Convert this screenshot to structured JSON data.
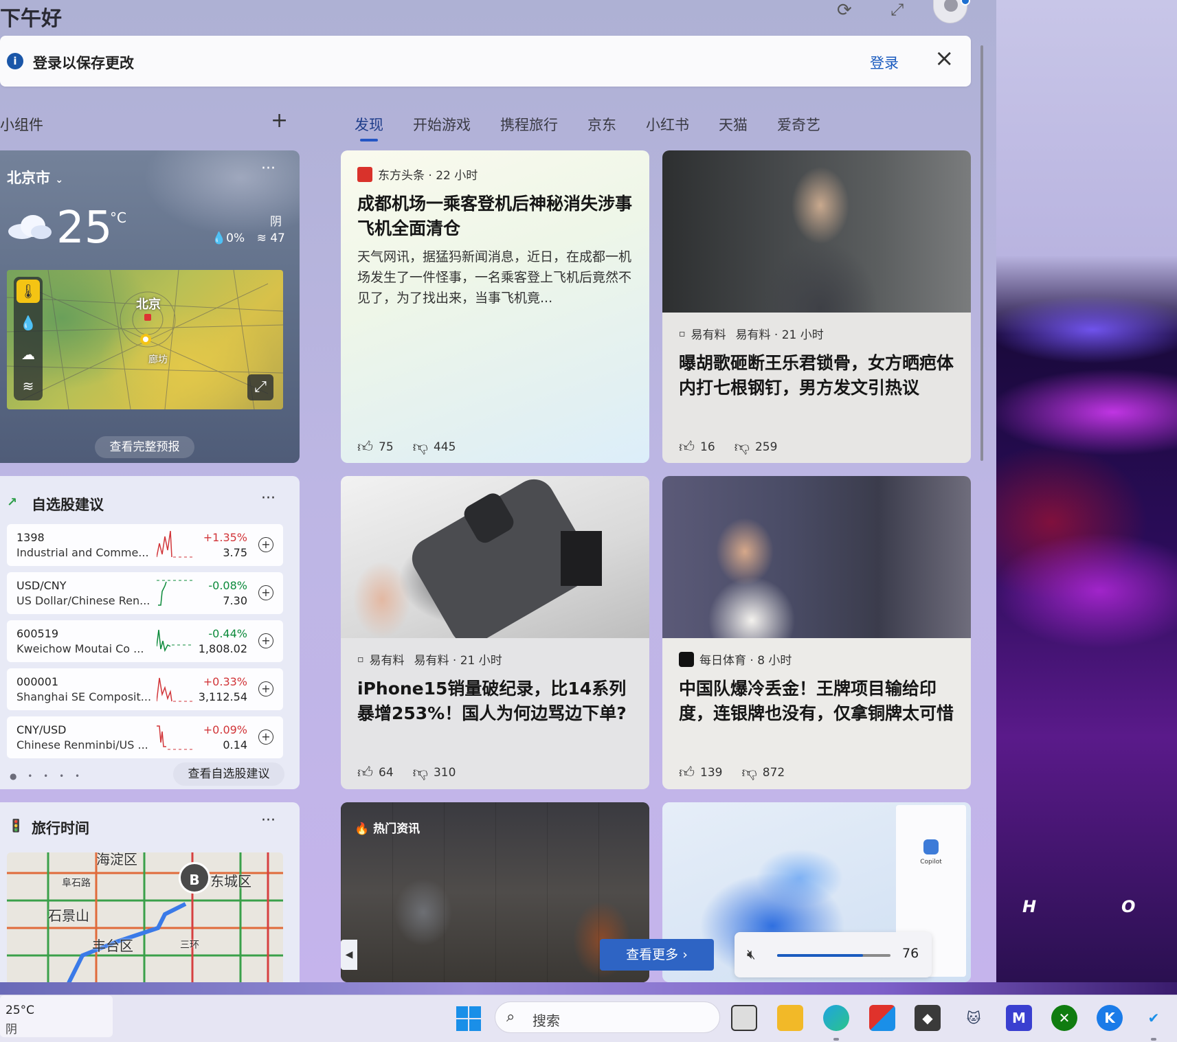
{
  "header": {
    "greeting": "下午好"
  },
  "notice": {
    "message": "登录以保存更改",
    "login_label": "登录"
  },
  "widgets": {
    "title": "小组件"
  },
  "tabs": [
    "发现",
    "开始游戏",
    "携程旅行",
    "京东",
    "小红书",
    "天猫",
    "爱奇艺"
  ],
  "weather": {
    "city": "北京市",
    "temperature": "25",
    "unit": "°C",
    "condition": "阴",
    "precip": "0%",
    "aqi_label": "47",
    "map_labels": {
      "city": "北京",
      "town": "廊坊"
    },
    "forecast_label": "查看完整预报"
  },
  "stocks": {
    "title": "自选股建议",
    "see_label": "查看自选股建议",
    "items": [
      {
        "symbol": "1398",
        "name": "Industrial and Comme...",
        "change": "+1.35%",
        "price": "3.75",
        "direction": "up"
      },
      {
        "symbol": "USD/CNY",
        "name": "US Dollar/Chinese Ren...",
        "change": "-0.08%",
        "price": "7.30",
        "direction": "down"
      },
      {
        "symbol": "600519",
        "name": "Kweichow Moutai Co ...",
        "change": "-0.44%",
        "price": "1,808.02",
        "direction": "down"
      },
      {
        "symbol": "000001",
        "name": "Shanghai SE Composit...",
        "change": "+0.33%",
        "price": "3,112.54",
        "direction": "up"
      },
      {
        "symbol": "CNY/USD",
        "name": "Chinese Renminbi/US ...",
        "change": "+0.09%",
        "price": "0.14",
        "direction": "up"
      }
    ]
  },
  "travel": {
    "title": "旅行时间",
    "map_labels": {
      "a": "海淀区",
      "b": "东城区",
      "c": "石景山",
      "d": "丰台区",
      "e": "阜石路",
      "f": "三环"
    },
    "marker": "B"
  },
  "cards": {
    "c1": {
      "source": "东方头条 · 22 小时",
      "headline": "成都机场一乘客登机后神秘消失涉事飞机全面清仓",
      "summary": "天气网讯，据猛犸新闻消息，近日，在成都一机场发生了一件怪事，一名乘客登上飞机后竟然不见了，为了找出来，当事飞机竟...",
      "likes": "75",
      "dislikes": "445"
    },
    "c2": {
      "source_logo_alt": "易有料",
      "source": "易有料 · 21 小时",
      "headline": "曝胡歌砸断王乐君锁骨，女方晒疤体内打七根钢钉，男方发文引热议",
      "likes": "16",
      "dislikes": "259"
    },
    "c3": {
      "source_logo_alt": "易有料",
      "source": "易有料 · 21 小时",
      "headline": "iPhone15销量破纪录，比14系列暴增253%！国人为何边骂边下单?",
      "likes": "64",
      "dislikes": "310"
    },
    "c4": {
      "source": "每日体育 · 8 小时",
      "headline": "中国队爆冷丢金！王牌项目输给印度，连银牌也没有，仅拿铜牌太可惜",
      "likes": "139",
      "dislikes": "872"
    },
    "c5": {
      "label": "热门资讯"
    },
    "c6": {
      "pane_title": "Copilot"
    }
  },
  "see_more_label": "查看更多",
  "volume": {
    "value": "76",
    "level": 0.76
  },
  "taskbar": {
    "weather_temp": "25°C",
    "weather_cond": "阴",
    "search_placeholder": "搜索"
  },
  "wallpaper": {
    "letter_1": "H",
    "letter_2": "O"
  },
  "colors": {
    "accent": "#2456c4",
    "up": "#d13438",
    "down": "#0b8a3a"
  }
}
